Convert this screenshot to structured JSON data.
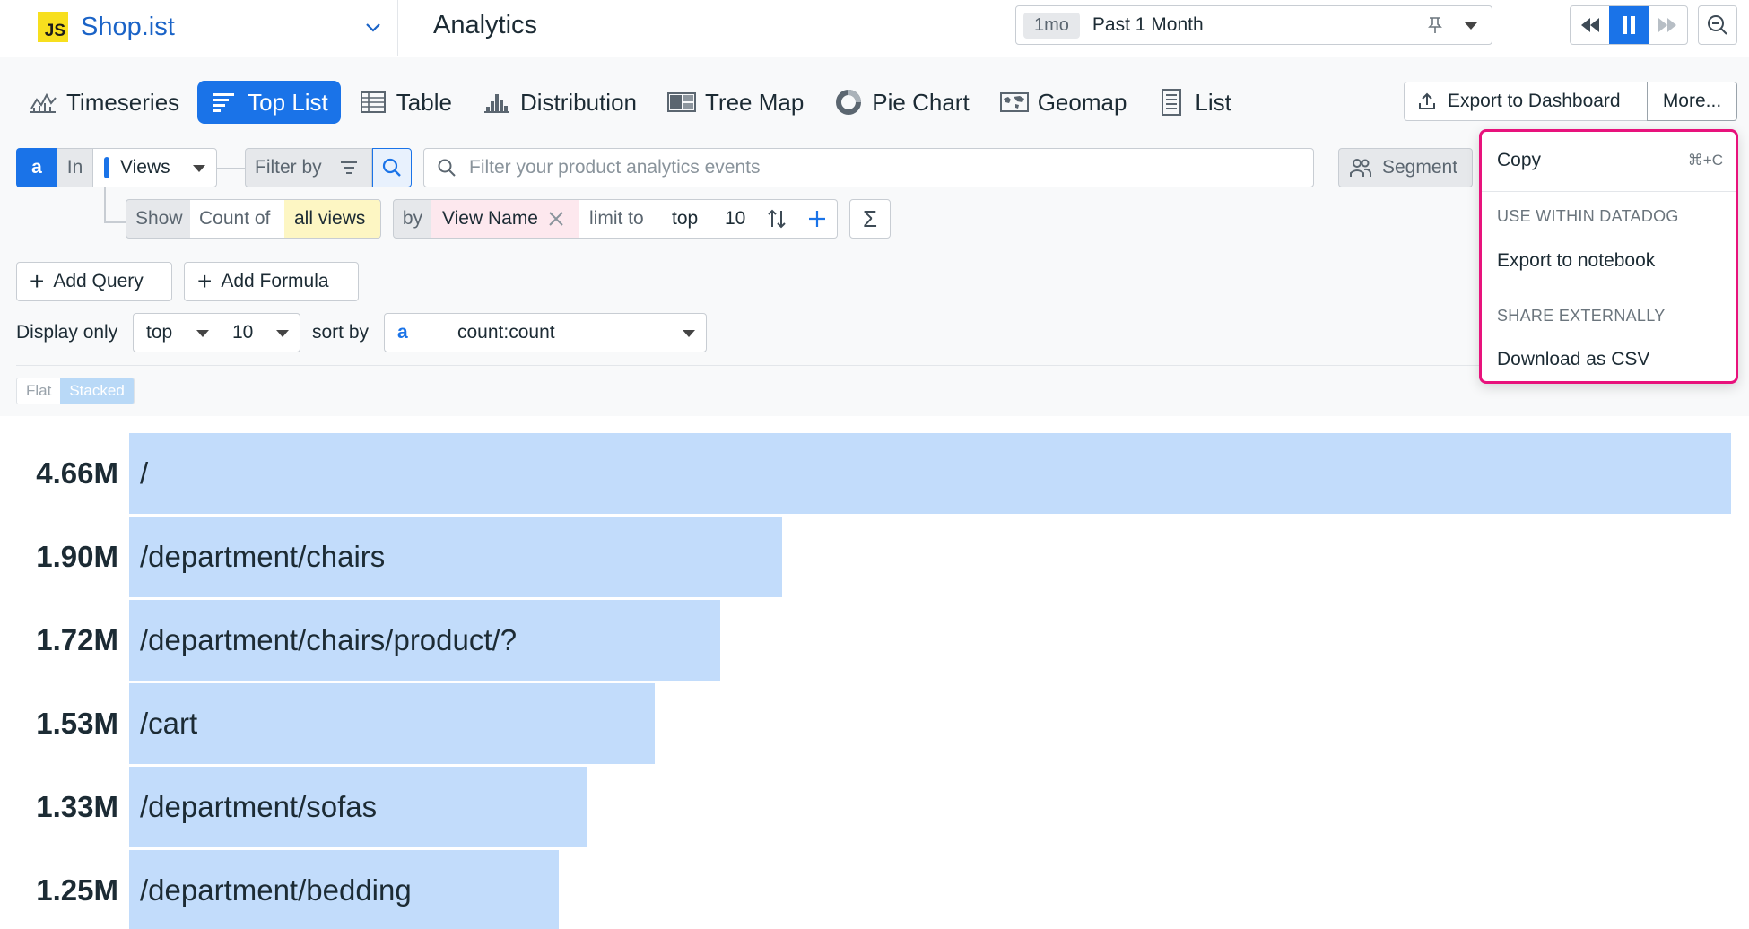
{
  "app": {
    "name": "Shop.ist",
    "logo_text": "JS"
  },
  "header": {
    "title": "Analytics",
    "time_badge": "1mo",
    "time_label": "Past 1 Month"
  },
  "viz_tabs": [
    {
      "label": "Timeseries",
      "icon": "timeseries-icon"
    },
    {
      "label": "Top List",
      "icon": "toplist-icon",
      "active": true
    },
    {
      "label": "Table",
      "icon": "table-icon"
    },
    {
      "label": "Distribution",
      "icon": "distribution-icon"
    },
    {
      "label": "Tree Map",
      "icon": "treemap-icon"
    },
    {
      "label": "Pie Chart",
      "icon": "piechart-icon"
    },
    {
      "label": "Geomap",
      "icon": "geomap-icon"
    },
    {
      "label": "List",
      "icon": "list-icon"
    }
  ],
  "actions": {
    "export_label": "Export to Dashboard",
    "more_label": "More..."
  },
  "query": {
    "letter": "a",
    "in_label": "In",
    "source": "Views",
    "filter_by_label": "Filter by",
    "filter_placeholder": "Filter your product analytics events",
    "segment_label": "Segment",
    "show_label": "Show",
    "count_of_label": "Count of",
    "measure": "all views",
    "by_label": "by",
    "group_by": "View Name",
    "limit_label": "limit to",
    "limit_dir": "top",
    "limit_n": "10"
  },
  "buttons": {
    "add_query": "Add Query",
    "add_formula": "Add Formula"
  },
  "display": {
    "display_only_label": "Display only",
    "display_dir": "top",
    "display_n": "10",
    "sort_by_label": "sort by",
    "sort_letter": "a",
    "sort_value": "count:count"
  },
  "toggle": {
    "flat": "Flat",
    "stacked": "Stacked",
    "selected": "Stacked"
  },
  "chart_data": {
    "type": "bar",
    "orientation": "horizontal",
    "categories": [
      "/",
      "/department/chairs",
      "/department/chairs/product/?",
      "/cart",
      "/department/sofas",
      "/department/bedding"
    ],
    "values": [
      4660000,
      1900000,
      1720000,
      1530000,
      1330000,
      1250000
    ],
    "value_labels": [
      "4.66M",
      "1.90M",
      "1.72M",
      "1.53M",
      "1.33M",
      "1.25M"
    ],
    "bar_color": "#c2dcfb"
  },
  "more_menu": {
    "copy_label": "Copy",
    "copy_shortcut": "⌘+C",
    "section_datadog": "USE WITHIN DATADOG",
    "export_notebook": "Export to notebook",
    "section_share": "SHARE EXTERNALLY",
    "download_csv": "Download as CSV",
    "highlight_color": "#e8127c"
  },
  "colors": {
    "accent": "#1a73e8",
    "brand": "#1a63c7"
  }
}
